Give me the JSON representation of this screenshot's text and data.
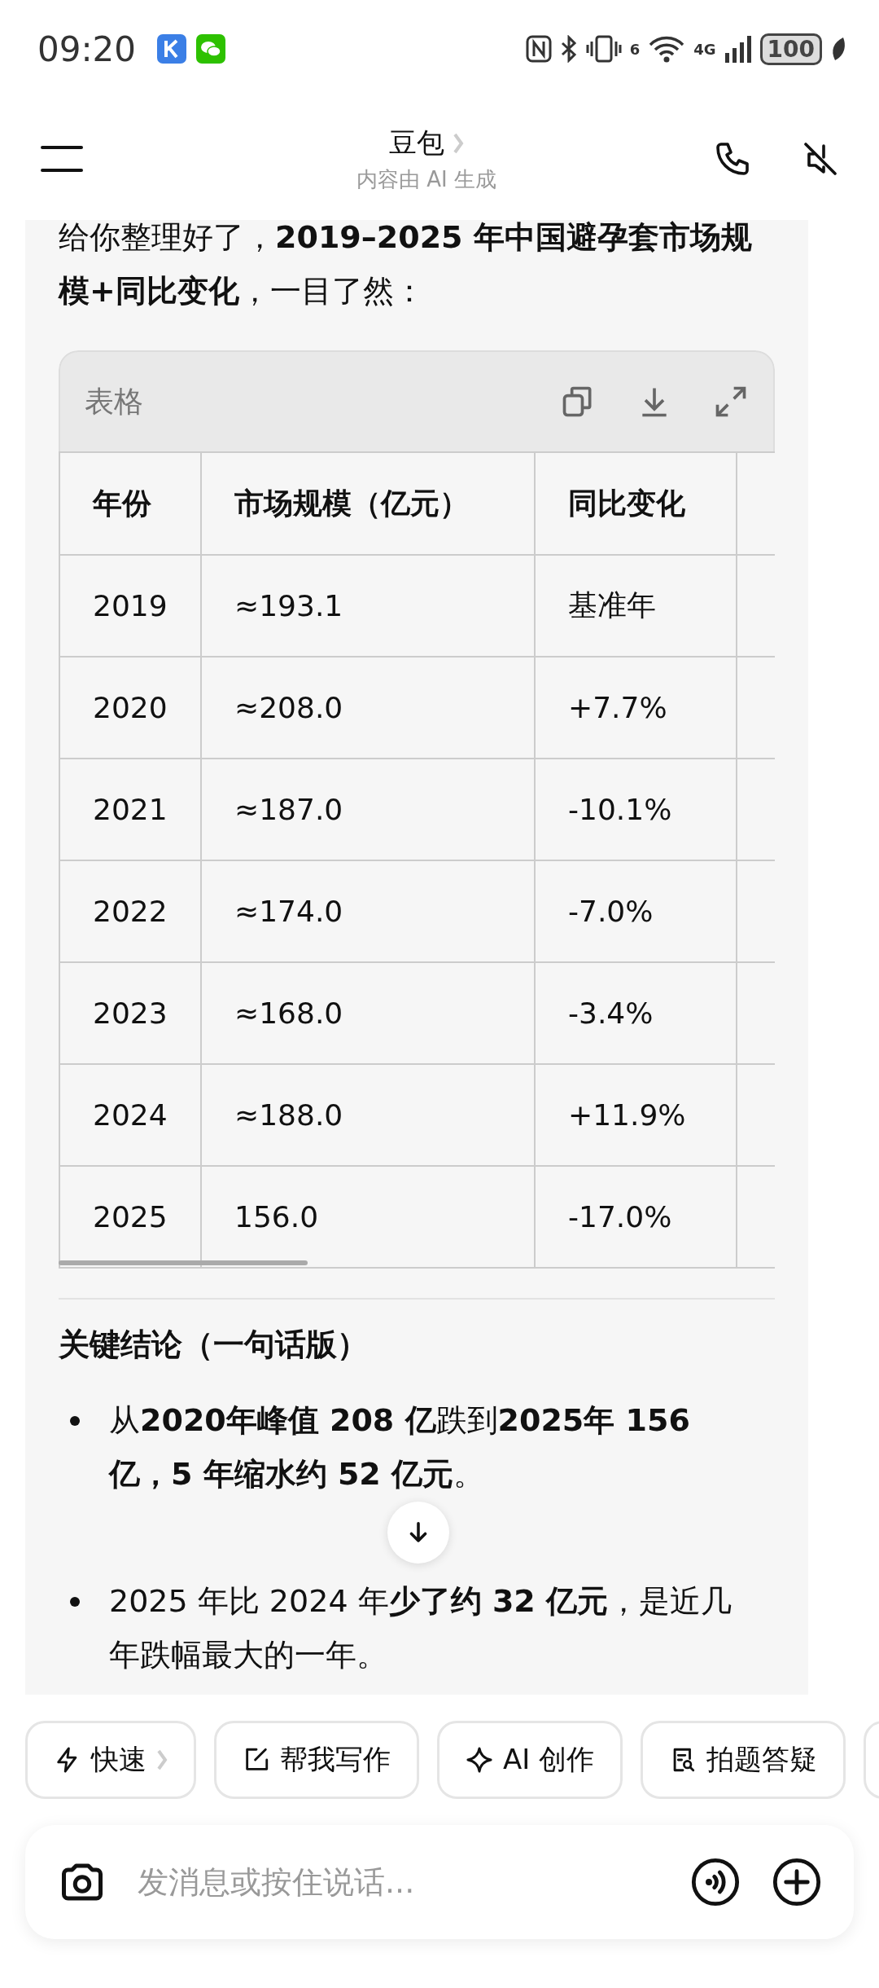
{
  "status_bar": {
    "time": "09:20",
    "wifi_label": "6",
    "network_label": "4G",
    "battery": "100"
  },
  "header": {
    "title": "豆包",
    "subtitle": "内容由 AI 生成"
  },
  "message": {
    "intro": "给你整理好了，**2019–2025 年中国避孕套市场规模+同比变化**，一目了然：",
    "table": {
      "title": "表格",
      "columns": [
        "年份",
        "市场规模（亿元）",
        "同比变化"
      ],
      "rows": [
        [
          "2019",
          "≈193.1",
          "基准年"
        ],
        [
          "2020",
          "≈208.0",
          "+7.7%"
        ],
        [
          "2021",
          "≈187.0",
          "-10.1%"
        ],
        [
          "2022",
          "≈174.0",
          "-7.0%"
        ],
        [
          "2023",
          "≈168.0",
          "-3.4%"
        ],
        [
          "2024",
          "≈188.0",
          "+11.9%"
        ],
        [
          "2025",
          "156.0",
          "-17.0%"
        ]
      ]
    },
    "section_title": "关键结论（一句话版）",
    "bullets": [
      "从**2020年峰值 208 亿**跌到**2025年 156 亿，5 年缩水约 52 亿元**。",
      "2025 年比 2024 年**少了约 32 亿元**，是近几年跌幅最大的一年。"
    ]
  },
  "chips": [
    {
      "kind": "bolt",
      "label": "快速",
      "chevron": true
    },
    {
      "kind": "edit",
      "label": "帮我写作",
      "chevron": false
    },
    {
      "kind": "sparkle",
      "label": "AI 创作",
      "chevron": false
    },
    {
      "kind": "doc-search",
      "label": "拍题答疑",
      "chevron": false
    }
  ],
  "input": {
    "placeholder": "发消息或按住说话..."
  }
}
